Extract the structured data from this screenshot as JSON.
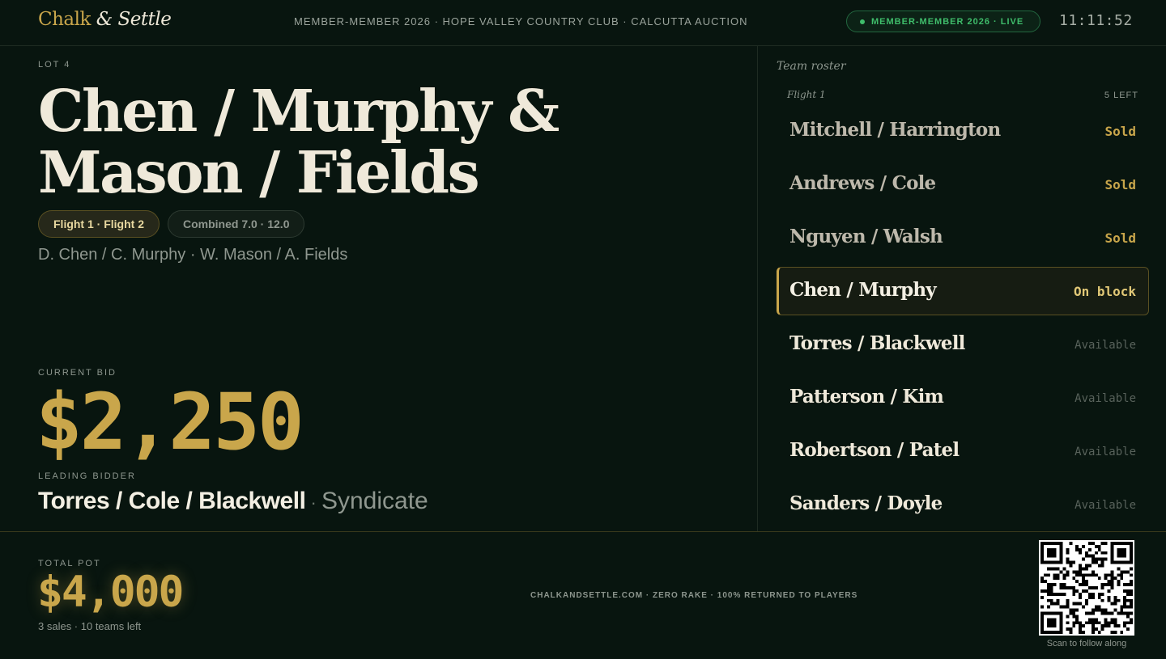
{
  "header": {
    "brand_part1": "Chalk",
    "brand_amp": "&",
    "brand_part2": "Settle",
    "event_line": "MEMBER-MEMBER 2026 · HOPE VALLEY COUNTRY CLUB · CALCUTTA AUCTION",
    "live_badge": "MEMBER-MEMBER 2026 · LIVE",
    "clock": "11:11:52"
  },
  "lot": {
    "label": "LOT 4",
    "title": "Chen / Murphy & Mason / Fields",
    "flights_chip": "Flight 1 · Flight 2",
    "combined_chip": "Combined 7.0 · 12.0",
    "players": "D. Chen / C. Murphy · W. Mason / A. Fields"
  },
  "bid": {
    "label": "CURRENT BID",
    "amount": "$2,250",
    "leader_label": "LEADING BIDDER",
    "leader_name": "Torres / Cole / Blackwell",
    "leader_sep": " · ",
    "leader_type": "Syndicate"
  },
  "roster": {
    "title": "Team roster",
    "flight_name": "Flight 1",
    "flight_left": "5 LEFT",
    "teams": [
      {
        "name": "Mitchell / Harrington",
        "status": "Sold",
        "state": "sold"
      },
      {
        "name": "Andrews / Cole",
        "status": "Sold",
        "state": "sold"
      },
      {
        "name": "Nguyen / Walsh",
        "status": "Sold",
        "state": "sold"
      },
      {
        "name": "Chen / Murphy",
        "status": "On block",
        "state": "onblock"
      },
      {
        "name": "Torres / Blackwell",
        "status": "Available",
        "state": "available"
      },
      {
        "name": "Patterson / Kim",
        "status": "Available",
        "state": "available"
      },
      {
        "name": "Robertson / Patel",
        "status": "Available",
        "state": "available"
      },
      {
        "name": "Sanders / Doyle",
        "status": "Available",
        "state": "available"
      }
    ]
  },
  "footer": {
    "pot_label": "TOTAL POT",
    "pot_amount": "$4,000",
    "pot_sub": "3 sales · 10 teams left",
    "tagline": "CHALKANDSETTLE.COM · ZERO RAKE · 100% RETURNED TO PLAYERS",
    "qr_caption": "Scan to follow along",
    "qr_icon": "qr-code-icon"
  },
  "colors": {
    "background": "#08150f",
    "gold": "#c9a64b",
    "live_green": "#3fbd6b",
    "text": "#eee8d8"
  }
}
